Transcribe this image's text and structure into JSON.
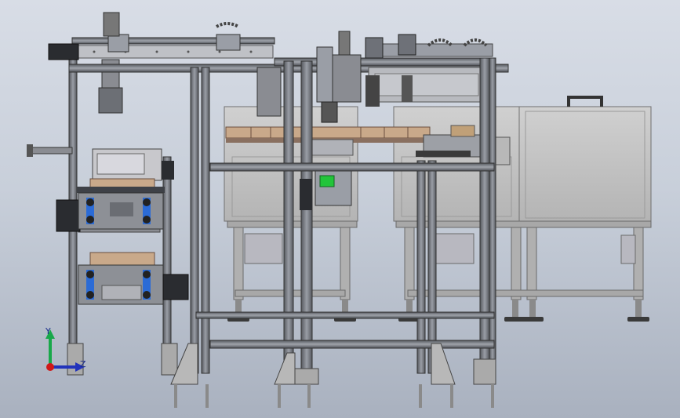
{
  "viewport": {
    "background_top": "#d8dde6",
    "background_bottom": "#a9b1bf"
  },
  "model": {
    "frame_color": "#7c8088",
    "frame_dark": "#3e4147",
    "cabinet_color": "#c4c4c4",
    "tray_color": "#c9a98a",
    "motor_color": "#2a2c30",
    "belt_color": "#2b6bd6",
    "accent_green": "#22c43a"
  },
  "triad": {
    "y_label": "Y",
    "z_label": "Z",
    "y_color": "#18a84a",
    "z_color": "#2233bb",
    "origin_color": "#d01818"
  }
}
